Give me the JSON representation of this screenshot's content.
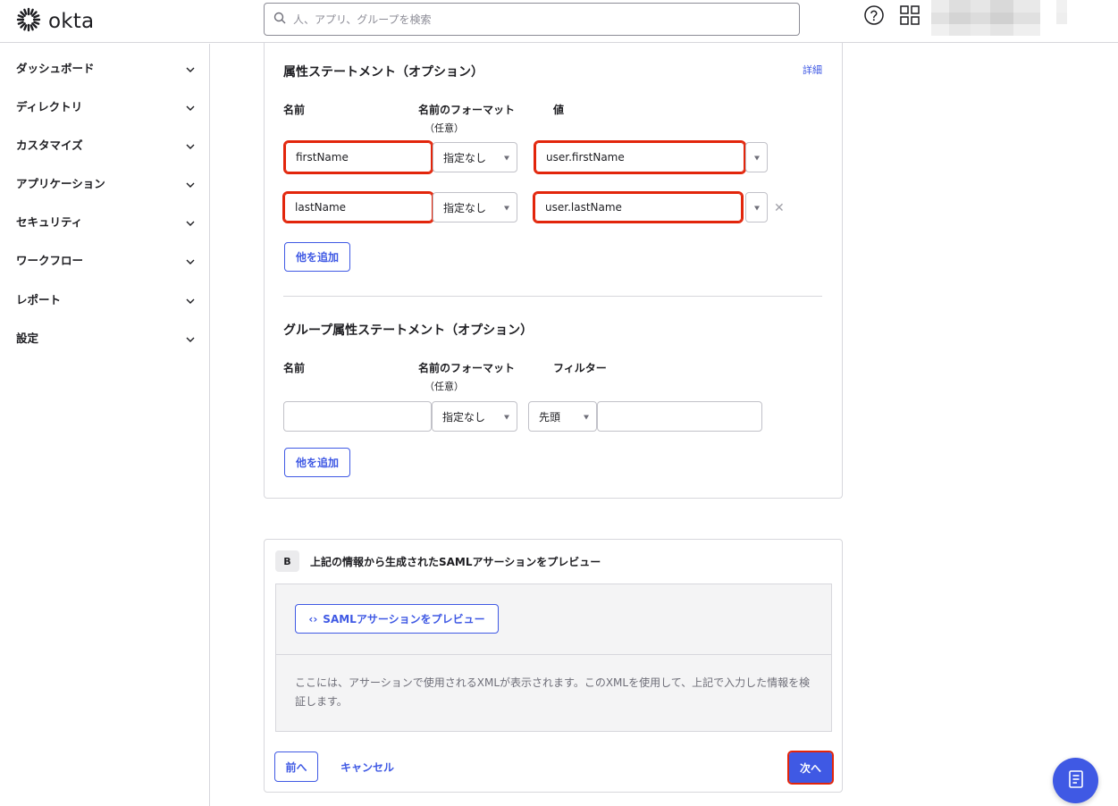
{
  "brand": {
    "name": "okta",
    "accent": "#3f59e4",
    "highlight": "#e2250b"
  },
  "search": {
    "placeholder": "人、アプリ、グループを検索",
    "value": ""
  },
  "icons": {
    "help": "help-circle-icon",
    "apps": "grid-apps-icon",
    "chevron": "chevron-down-icon",
    "fab": "notebook-icon"
  },
  "sidebar": {
    "items": [
      {
        "label": "ダッシュボード"
      },
      {
        "label": "ディレクトリ"
      },
      {
        "label": "カスタマイズ"
      },
      {
        "label": "アプリケーション"
      },
      {
        "label": "セキュリティ"
      },
      {
        "label": "ワークフロー"
      },
      {
        "label": "レポート"
      },
      {
        "label": "設定"
      }
    ]
  },
  "attributes": {
    "title": "属性ステートメント（オプション）",
    "detail_link": "詳細",
    "col_name": "名前",
    "col_format": "名前のフォーマット",
    "col_format_sub": "（任意）",
    "col_value": "値",
    "rows": [
      {
        "name": "firstName",
        "format": "指定なし",
        "value": "user.firstName"
      },
      {
        "name": "lastName",
        "format": "指定なし",
        "value": "user.lastName"
      }
    ],
    "add_more": "他を追加",
    "remove": "✕"
  },
  "group_attributes": {
    "title": "グループ属性ステートメント（オプション）",
    "col_name": "名前",
    "col_format": "名前のフォーマット",
    "col_format_sub": "（任意）",
    "col_filter": "フィルター",
    "row": {
      "name": "",
      "format": "指定なし",
      "filter_type": "先頭",
      "filter_value": ""
    },
    "add_more": "他を追加"
  },
  "preview": {
    "badge": "B",
    "title": "上記の情報から生成されたSAMLアサーションをプレビュー",
    "button": "SAMLアサーションをプレビュー",
    "button_icon": "‹›",
    "description": "ここには、アサーションで使用されるXMLが表示されます。このXMLを使用して、上記で入力した情報を検証します。"
  },
  "footer": {
    "prev": "前へ",
    "cancel": "キャンセル",
    "next": "次へ"
  }
}
